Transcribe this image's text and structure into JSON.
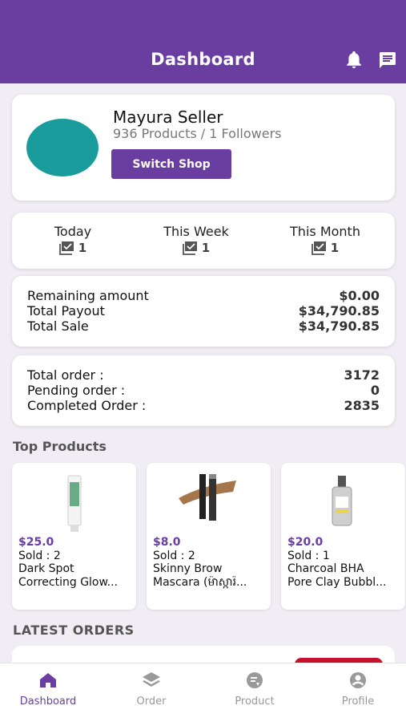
{
  "header": {
    "title": "Dashboard"
  },
  "shop": {
    "seller_name": "Mayura Seller",
    "meta": "936 Products / 1 Followers",
    "switch_label": "Switch Shop",
    "avatar_color": "#1a9c9c"
  },
  "periods": [
    {
      "label": "Today",
      "count": "1"
    },
    {
      "label": "This Week",
      "count": "1"
    },
    {
      "label": "This Month",
      "count": "1"
    }
  ],
  "finance": [
    {
      "label": "Remaining amount",
      "value": "$0.00"
    },
    {
      "label": "Total Payout",
      "value": "$34,790.85"
    },
    {
      "label": "Total Sale",
      "value": "$34,790.85"
    }
  ],
  "order_stats": [
    {
      "label": "Total order :",
      "value": "3172"
    },
    {
      "label": "Pending order :",
      "value": "0"
    },
    {
      "label": "Completed Order :",
      "value": "2835"
    }
  ],
  "top_products": {
    "title": "Top Products",
    "items": [
      {
        "price": "$25.0",
        "sold": "Sold : 2",
        "name_line1": "Dark Spot",
        "name_line2": "Correcting Glow...",
        "image": "tube-icon"
      },
      {
        "price": "$8.0",
        "sold": "Sold : 2",
        "name_line1": "Skinny Brow",
        "name_line2": "Mascara (ម៉ាស្ការ៉...",
        "image": "mascara-icon"
      },
      {
        "price": "$20.0",
        "sold": "Sold : 1",
        "name_line1": "Charcoal BHA",
        "name_line2": "Pore Clay Bubbl...",
        "image": "bottle-icon"
      }
    ]
  },
  "latest_orders": {
    "title": "LATEST ORDERS"
  },
  "bottom_nav": [
    {
      "label": "Dashboard",
      "icon": "home-icon",
      "active": true
    },
    {
      "label": "Order",
      "icon": "layers-icon",
      "active": false
    },
    {
      "label": "Product",
      "icon": "product-icon",
      "active": false
    },
    {
      "label": "Profile",
      "icon": "person-icon",
      "active": false
    }
  ],
  "colors": {
    "primary": "#6a3ea1",
    "background": "#f0eef4",
    "badge": "#c8102e"
  }
}
